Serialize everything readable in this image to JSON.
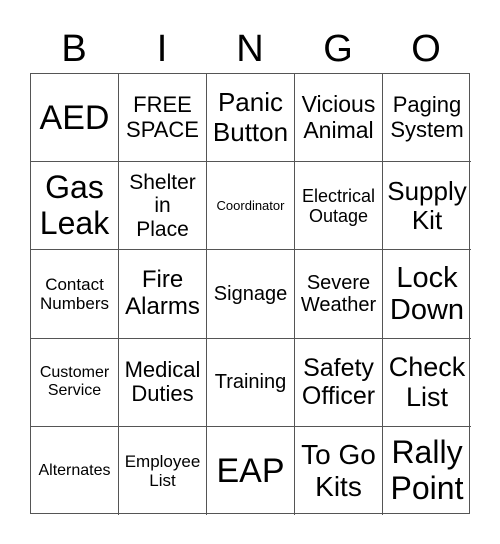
{
  "header": [
    "B",
    "I",
    "N",
    "G",
    "O"
  ],
  "cells": [
    [
      "AED",
      "FREE SPACE",
      "Panic Button",
      "Vicious Animal",
      "Paging System"
    ],
    [
      "Gas Leak",
      "Shelter in Place",
      "Coordinator",
      "Electrical Outage",
      "Supply Kit"
    ],
    [
      "Contact Numbers",
      "Fire Alarms",
      "Signage",
      "Severe Weather",
      "Lock Down"
    ],
    [
      "Customer Service",
      "Medical Duties",
      "Training",
      "Safety Officer",
      "Check List"
    ],
    [
      "Alternates",
      "Employee List",
      "EAP",
      "To Go Kits",
      "Rally Point"
    ]
  ]
}
